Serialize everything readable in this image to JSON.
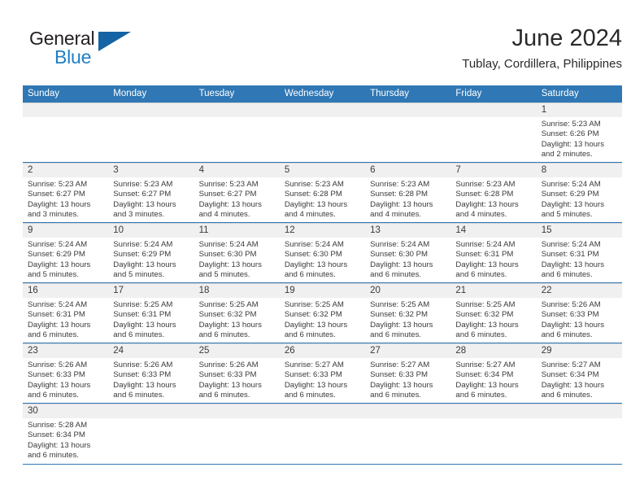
{
  "logo": {
    "word_top": "General",
    "word_bottom": "Blue",
    "triangle_color": "#1463a5",
    "blue_text_color": "#1f7ec4"
  },
  "header": {
    "title": "June 2024",
    "subtitle": "Tublay, Cordillera, Philippines"
  },
  "theme": {
    "header_blue": "#2f77b5",
    "day_strip_gray": "#f0f0f0",
    "text_color": "#3a3a3a"
  },
  "weekdays": [
    "Sunday",
    "Monday",
    "Tuesday",
    "Wednesday",
    "Thursday",
    "Friday",
    "Saturday"
  ],
  "weeks": [
    [
      {
        "day": "",
        "sunrise": "",
        "sunset": "",
        "daylight_line1": "",
        "daylight_line2": ""
      },
      {
        "day": "",
        "sunrise": "",
        "sunset": "",
        "daylight_line1": "",
        "daylight_line2": ""
      },
      {
        "day": "",
        "sunrise": "",
        "sunset": "",
        "daylight_line1": "",
        "daylight_line2": ""
      },
      {
        "day": "",
        "sunrise": "",
        "sunset": "",
        "daylight_line1": "",
        "daylight_line2": ""
      },
      {
        "day": "",
        "sunrise": "",
        "sunset": "",
        "daylight_line1": "",
        "daylight_line2": ""
      },
      {
        "day": "",
        "sunrise": "",
        "sunset": "",
        "daylight_line1": "",
        "daylight_line2": ""
      },
      {
        "day": "1",
        "sunrise": "Sunrise: 5:23 AM",
        "sunset": "Sunset: 6:26 PM",
        "daylight_line1": "Daylight: 13 hours",
        "daylight_line2": "and 2 minutes."
      }
    ],
    [
      {
        "day": "2",
        "sunrise": "Sunrise: 5:23 AM",
        "sunset": "Sunset: 6:27 PM",
        "daylight_line1": "Daylight: 13 hours",
        "daylight_line2": "and 3 minutes."
      },
      {
        "day": "3",
        "sunrise": "Sunrise: 5:23 AM",
        "sunset": "Sunset: 6:27 PM",
        "daylight_line1": "Daylight: 13 hours",
        "daylight_line2": "and 3 minutes."
      },
      {
        "day": "4",
        "sunrise": "Sunrise: 5:23 AM",
        "sunset": "Sunset: 6:27 PM",
        "daylight_line1": "Daylight: 13 hours",
        "daylight_line2": "and 4 minutes."
      },
      {
        "day": "5",
        "sunrise": "Sunrise: 5:23 AM",
        "sunset": "Sunset: 6:28 PM",
        "daylight_line1": "Daylight: 13 hours",
        "daylight_line2": "and 4 minutes."
      },
      {
        "day": "6",
        "sunrise": "Sunrise: 5:23 AM",
        "sunset": "Sunset: 6:28 PM",
        "daylight_line1": "Daylight: 13 hours",
        "daylight_line2": "and 4 minutes."
      },
      {
        "day": "7",
        "sunrise": "Sunrise: 5:23 AM",
        "sunset": "Sunset: 6:28 PM",
        "daylight_line1": "Daylight: 13 hours",
        "daylight_line2": "and 4 minutes."
      },
      {
        "day": "8",
        "sunrise": "Sunrise: 5:24 AM",
        "sunset": "Sunset: 6:29 PM",
        "daylight_line1": "Daylight: 13 hours",
        "daylight_line2": "and 5 minutes."
      }
    ],
    [
      {
        "day": "9",
        "sunrise": "Sunrise: 5:24 AM",
        "sunset": "Sunset: 6:29 PM",
        "daylight_line1": "Daylight: 13 hours",
        "daylight_line2": "and 5 minutes."
      },
      {
        "day": "10",
        "sunrise": "Sunrise: 5:24 AM",
        "sunset": "Sunset: 6:29 PM",
        "daylight_line1": "Daylight: 13 hours",
        "daylight_line2": "and 5 minutes."
      },
      {
        "day": "11",
        "sunrise": "Sunrise: 5:24 AM",
        "sunset": "Sunset: 6:30 PM",
        "daylight_line1": "Daylight: 13 hours",
        "daylight_line2": "and 5 minutes."
      },
      {
        "day": "12",
        "sunrise": "Sunrise: 5:24 AM",
        "sunset": "Sunset: 6:30 PM",
        "daylight_line1": "Daylight: 13 hours",
        "daylight_line2": "and 6 minutes."
      },
      {
        "day": "13",
        "sunrise": "Sunrise: 5:24 AM",
        "sunset": "Sunset: 6:30 PM",
        "daylight_line1": "Daylight: 13 hours",
        "daylight_line2": "and 6 minutes."
      },
      {
        "day": "14",
        "sunrise": "Sunrise: 5:24 AM",
        "sunset": "Sunset: 6:31 PM",
        "daylight_line1": "Daylight: 13 hours",
        "daylight_line2": "and 6 minutes."
      },
      {
        "day": "15",
        "sunrise": "Sunrise: 5:24 AM",
        "sunset": "Sunset: 6:31 PM",
        "daylight_line1": "Daylight: 13 hours",
        "daylight_line2": "and 6 minutes."
      }
    ],
    [
      {
        "day": "16",
        "sunrise": "Sunrise: 5:24 AM",
        "sunset": "Sunset: 6:31 PM",
        "daylight_line1": "Daylight: 13 hours",
        "daylight_line2": "and 6 minutes."
      },
      {
        "day": "17",
        "sunrise": "Sunrise: 5:25 AM",
        "sunset": "Sunset: 6:31 PM",
        "daylight_line1": "Daylight: 13 hours",
        "daylight_line2": "and 6 minutes."
      },
      {
        "day": "18",
        "sunrise": "Sunrise: 5:25 AM",
        "sunset": "Sunset: 6:32 PM",
        "daylight_line1": "Daylight: 13 hours",
        "daylight_line2": "and 6 minutes."
      },
      {
        "day": "19",
        "sunrise": "Sunrise: 5:25 AM",
        "sunset": "Sunset: 6:32 PM",
        "daylight_line1": "Daylight: 13 hours",
        "daylight_line2": "and 6 minutes."
      },
      {
        "day": "20",
        "sunrise": "Sunrise: 5:25 AM",
        "sunset": "Sunset: 6:32 PM",
        "daylight_line1": "Daylight: 13 hours",
        "daylight_line2": "and 6 minutes."
      },
      {
        "day": "21",
        "sunrise": "Sunrise: 5:25 AM",
        "sunset": "Sunset: 6:32 PM",
        "daylight_line1": "Daylight: 13 hours",
        "daylight_line2": "and 6 minutes."
      },
      {
        "day": "22",
        "sunrise": "Sunrise: 5:26 AM",
        "sunset": "Sunset: 6:33 PM",
        "daylight_line1": "Daylight: 13 hours",
        "daylight_line2": "and 6 minutes."
      }
    ],
    [
      {
        "day": "23",
        "sunrise": "Sunrise: 5:26 AM",
        "sunset": "Sunset: 6:33 PM",
        "daylight_line1": "Daylight: 13 hours",
        "daylight_line2": "and 6 minutes."
      },
      {
        "day": "24",
        "sunrise": "Sunrise: 5:26 AM",
        "sunset": "Sunset: 6:33 PM",
        "daylight_line1": "Daylight: 13 hours",
        "daylight_line2": "and 6 minutes."
      },
      {
        "day": "25",
        "sunrise": "Sunrise: 5:26 AM",
        "sunset": "Sunset: 6:33 PM",
        "daylight_line1": "Daylight: 13 hours",
        "daylight_line2": "and 6 minutes."
      },
      {
        "day": "26",
        "sunrise": "Sunrise: 5:27 AM",
        "sunset": "Sunset: 6:33 PM",
        "daylight_line1": "Daylight: 13 hours",
        "daylight_line2": "and 6 minutes."
      },
      {
        "day": "27",
        "sunrise": "Sunrise: 5:27 AM",
        "sunset": "Sunset: 6:33 PM",
        "daylight_line1": "Daylight: 13 hours",
        "daylight_line2": "and 6 minutes."
      },
      {
        "day": "28",
        "sunrise": "Sunrise: 5:27 AM",
        "sunset": "Sunset: 6:34 PM",
        "daylight_line1": "Daylight: 13 hours",
        "daylight_line2": "and 6 minutes."
      },
      {
        "day": "29",
        "sunrise": "Sunrise: 5:27 AM",
        "sunset": "Sunset: 6:34 PM",
        "daylight_line1": "Daylight: 13 hours",
        "daylight_line2": "and 6 minutes."
      }
    ],
    [
      {
        "day": "30",
        "sunrise": "Sunrise: 5:28 AM",
        "sunset": "Sunset: 6:34 PM",
        "daylight_line1": "Daylight: 13 hours",
        "daylight_line2": "and 6 minutes."
      },
      {
        "day": "",
        "sunrise": "",
        "sunset": "",
        "daylight_line1": "",
        "daylight_line2": ""
      },
      {
        "day": "",
        "sunrise": "",
        "sunset": "",
        "daylight_line1": "",
        "daylight_line2": ""
      },
      {
        "day": "",
        "sunrise": "",
        "sunset": "",
        "daylight_line1": "",
        "daylight_line2": ""
      },
      {
        "day": "",
        "sunrise": "",
        "sunset": "",
        "daylight_line1": "",
        "daylight_line2": ""
      },
      {
        "day": "",
        "sunrise": "",
        "sunset": "",
        "daylight_line1": "",
        "daylight_line2": ""
      },
      {
        "day": "",
        "sunrise": "",
        "sunset": "",
        "daylight_line1": "",
        "daylight_line2": ""
      }
    ]
  ]
}
